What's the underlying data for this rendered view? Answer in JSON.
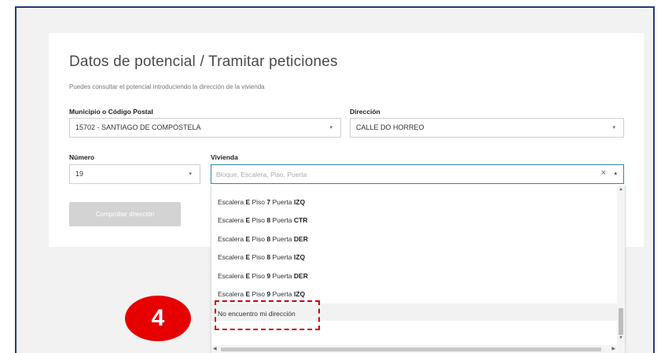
{
  "page": {
    "title": "Datos de potencial / Tramitar peticiones",
    "subtitle": "Puedes consultar el potencial introduciendo la dirección de la vivienda"
  },
  "form": {
    "municipio_label": "Municipio o Código Postal",
    "municipio_value": "15702 - SANTIAGO DE COMPOSTELA",
    "direccion_label": "Dirección",
    "direccion_value": "CALLE DO HORREO",
    "numero_label": "Número",
    "numero_value": "19",
    "vivienda_label": "Vivienda",
    "vivienda_placeholder": "Bloque, Escalera, Piso, Puerta",
    "check_button": "Comprobar dirección"
  },
  "dropdown": {
    "options": [
      {
        "p1": "Escalera ",
        "v1": "E",
        "p2": " Piso ",
        "v2": "7",
        "p3": " Puerta ",
        "v3": "IZQ"
      },
      {
        "p1": "Escalera ",
        "v1": "E",
        "p2": " Piso ",
        "v2": "8",
        "p3": " Puerta ",
        "v3": "CTR"
      },
      {
        "p1": "Escalera ",
        "v1": "E",
        "p2": " Piso ",
        "v2": "8",
        "p3": " Puerta ",
        "v3": "DER"
      },
      {
        "p1": "Escalera ",
        "v1": "E",
        "p2": " Piso ",
        "v2": "8",
        "p3": " Puerta ",
        "v3": "IZQ"
      },
      {
        "p1": "Escalera ",
        "v1": "E",
        "p2": " Piso ",
        "v2": "9",
        "p3": " Puerta ",
        "v3": "DER"
      },
      {
        "p1": "Escalera ",
        "v1": "E",
        "p2": " Piso ",
        "v2": "9",
        "p3": " Puerta ",
        "v3": "IZQ"
      }
    ],
    "not_found": "No encuentro mi dirección"
  },
  "annotation": {
    "step_number": "4",
    "badge_color": "#e60000",
    "highlight_color": "#d00000"
  },
  "icons": {
    "caret": "▾",
    "caret_up": "▴",
    "clear": "×",
    "scroll_up": "▲",
    "scroll_down": "▼",
    "scroll_left": "◀",
    "scroll_right": "▶"
  }
}
